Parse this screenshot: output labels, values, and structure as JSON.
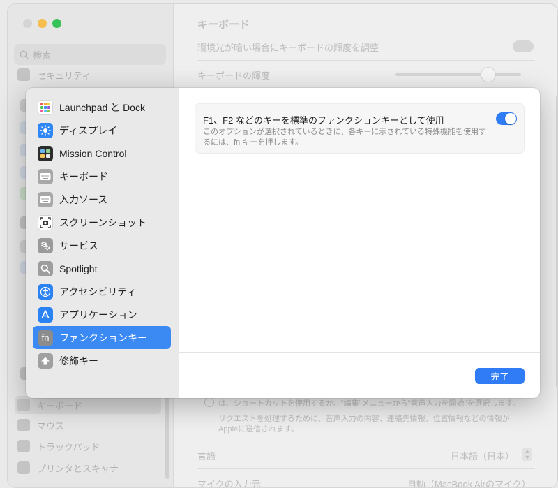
{
  "background": {
    "window_title": "キーボード",
    "search_placeholder": "検索",
    "sidebar_items": [
      {
        "label": "セキュリティ"
      },
      {
        "label": "キーボード"
      },
      {
        "label": "マウス"
      },
      {
        "label": "トラックパッド"
      },
      {
        "label": "プリンタとスキャナ"
      }
    ],
    "main": {
      "row_ambient": "環境光が暗い場合にキーボードの輝度を調整",
      "row_brightness": "キーボードの輝度",
      "dictation_note_1": "は、ショートカットを使用するか、\"編集\"メニューから\"音声入力を開始\"を選択します。",
      "dictation_note_2": "リクエストを処理するために、音声入力の内容、連絡先情報、位置情報などの情報が",
      "dictation_note_3": "Appleに送信されます。",
      "language_label": "言語",
      "language_value": "日本語（日本）",
      "mic_label": "マイクの入力元",
      "mic_value": "自動（MacBook Airのマイク）"
    }
  },
  "sheet": {
    "nav_items": [
      {
        "label": "Launchpad と Dock",
        "icon": "launchpad-icon",
        "selected": false
      },
      {
        "label": "ディスプレイ",
        "icon": "display-icon",
        "selected": false
      },
      {
        "label": "Mission Control",
        "icon": "mission-control-icon",
        "selected": false
      },
      {
        "label": "キーボード",
        "icon": "keyboard-icon",
        "selected": false
      },
      {
        "label": "入力ソース",
        "icon": "input-sources-icon",
        "selected": false
      },
      {
        "label": "スクリーンショット",
        "icon": "screenshot-icon",
        "selected": false
      },
      {
        "label": "サービス",
        "icon": "services-icon",
        "selected": false
      },
      {
        "label": "Spotlight",
        "icon": "spotlight-icon",
        "selected": false
      },
      {
        "label": "アクセシビリティ",
        "icon": "accessibility-icon",
        "selected": false
      },
      {
        "label": "アプリケーション",
        "icon": "app-store-icon",
        "selected": false
      },
      {
        "label": "ファンクションキー",
        "icon": "fn-icon",
        "selected": true
      },
      {
        "label": "修飾キー",
        "icon": "modifier-keys-icon",
        "selected": false
      }
    ],
    "option": {
      "title": "F1、F2 などのキーを標準のファンクションキーとして使用",
      "description": "このオプションが選択されているときに、各キーに示されている特殊機能を使用するには、fn キーを押します。",
      "enabled": true
    },
    "done_label": "完了",
    "fn_glyph": "fn"
  },
  "colors": {
    "accent": "#2f7cf6",
    "selected_nav": "#3b8af3"
  }
}
